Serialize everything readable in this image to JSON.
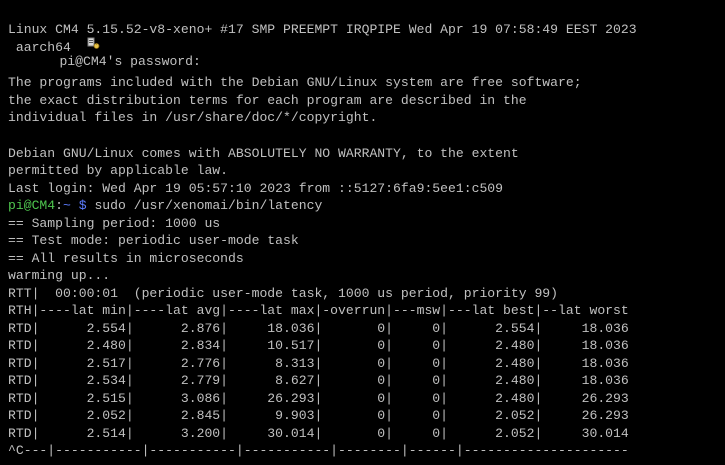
{
  "terminal": {
    "password_prompt": "pi@CM4's password:",
    "kernel_line": "Linux CM4 5.15.52-v8-xeno+ #17 SMP PREEMPT IRQPIPE Wed Apr 19 07:58:49 EEST 2023",
    "arch_line": " aarch64",
    "motd_1": "The programs included with the Debian GNU/Linux system are free software;",
    "motd_2": "the exact distribution terms for each program are described in the",
    "motd_3": "individual files in /usr/share/doc/*/copyright.",
    "warranty_1": "Debian GNU/Linux comes with ABSOLUTELY NO WARRANTY, to the extent",
    "warranty_2": "permitted by applicable law.",
    "last_login": "Last login: Wed Apr 19 05:57:10 2023 from ::5127:6fa9:5ee1:c509",
    "prompt": {
      "user_host": "pi@CM4",
      "sep": ":",
      "path": "~ $",
      "command": " sudo /usr/xenomai/bin/latency"
    },
    "output": {
      "sampling": "== Sampling period: 1000 us",
      "test_mode": "== Test mode: periodic user-mode task",
      "results_unit": "== All results in microseconds",
      "warming": "warming up...",
      "rtt": "RTT|  00:00:01  (periodic user-mode task, 1000 us period, priority 99)",
      "header": "RTH|----lat min|----lat avg|----lat max|-overrun|---msw|---lat best|--lat worst",
      "rows": [
        "RTD|      2.554|      2.876|     18.036|       0|     0|      2.554|     18.036",
        "RTD|      2.480|      2.834|     10.517|       0|     0|      2.480|     18.036",
        "RTD|      2.517|      2.776|      8.313|       0|     0|      2.480|     18.036",
        "RTD|      2.534|      2.779|      8.627|       0|     0|      2.480|     18.036",
        "RTD|      2.515|      3.086|     26.293|       0|     0|      2.480|     26.293",
        "RTD|      2.052|      2.845|      9.903|       0|     0|      2.052|     26.293",
        "RTD|      2.514|      3.200|     30.014|       0|     0|      2.052|     30.014"
      ],
      "interrupt": "^C---|-----------|-----------|-----------|--------|------|---------------------"
    }
  },
  "colors": {
    "background": "#000000",
    "text": "#c0c0c0",
    "prompt_user": "#4ec64e",
    "prompt_path": "#5c7cff"
  },
  "icons": {
    "prompt_marker": "key-icon"
  }
}
